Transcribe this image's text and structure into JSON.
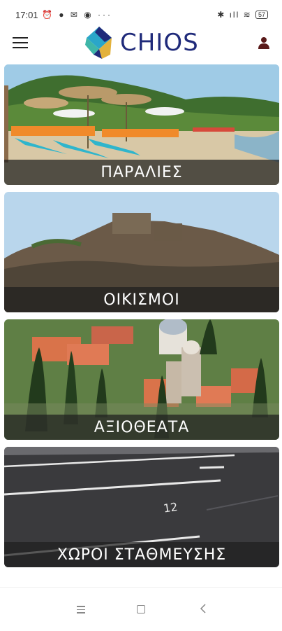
{
  "status": {
    "time": "17:01",
    "left_icons": "⏰ ● ✉ ◉ ···",
    "right_icons": "✱ ıll ≋",
    "battery": "57"
  },
  "header": {
    "logo_text": "CHIOS",
    "menu_icon": "hamburger-menu-icon",
    "user_icon": "user-icon",
    "brand_color": "#1f2a7a"
  },
  "cards": [
    {
      "label": "ΠΑΡΑΛΙΕΣ"
    },
    {
      "label": "ΟΙΚΙΣΜΟΙ"
    },
    {
      "label": "ΑΞΙΟΘΕΑΤΑ"
    },
    {
      "label": "ΧΩΡΟΙ ΣΤΑΘΜΕΥΣΗΣ"
    }
  ],
  "navbar": {
    "recent_icon": "recent-apps-icon",
    "home_icon": "home-icon",
    "back_icon": "back-icon"
  }
}
